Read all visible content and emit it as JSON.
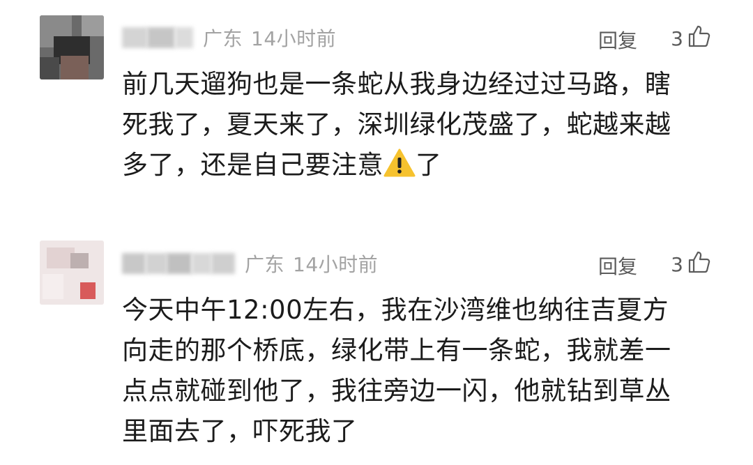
{
  "comments": [
    {
      "region": "广东",
      "time": "14小时前",
      "reply_label": "回复",
      "likes": "3",
      "lines": [
        "前几天遛狗也是一条蛇从我身边经过过马路，瞎",
        "死我了，夏天来了，深圳绿化茂盛了，蛇越来越",
        "多了，还是自己要注意",
        "了"
      ],
      "emoji": "warning-icon"
    },
    {
      "region": "广东",
      "time": "14小时前",
      "reply_label": "回复",
      "likes": "3",
      "lines": [
        "今天中午12:00左右，我在沙湾维也纳往吉夏方",
        "向走的那个桥底，绿化带上有一条蛇，我就差一",
        "点点就碰到他了，我往旁边一闪，他就钻到草丛",
        "里面去了，吓死我了"
      ]
    }
  ],
  "colors": {
    "meta_gray": "#a3a3a3",
    "action_gray": "#5b5b5b",
    "text": "#1b1b1b",
    "warn_yellow": "#f6c22e"
  }
}
